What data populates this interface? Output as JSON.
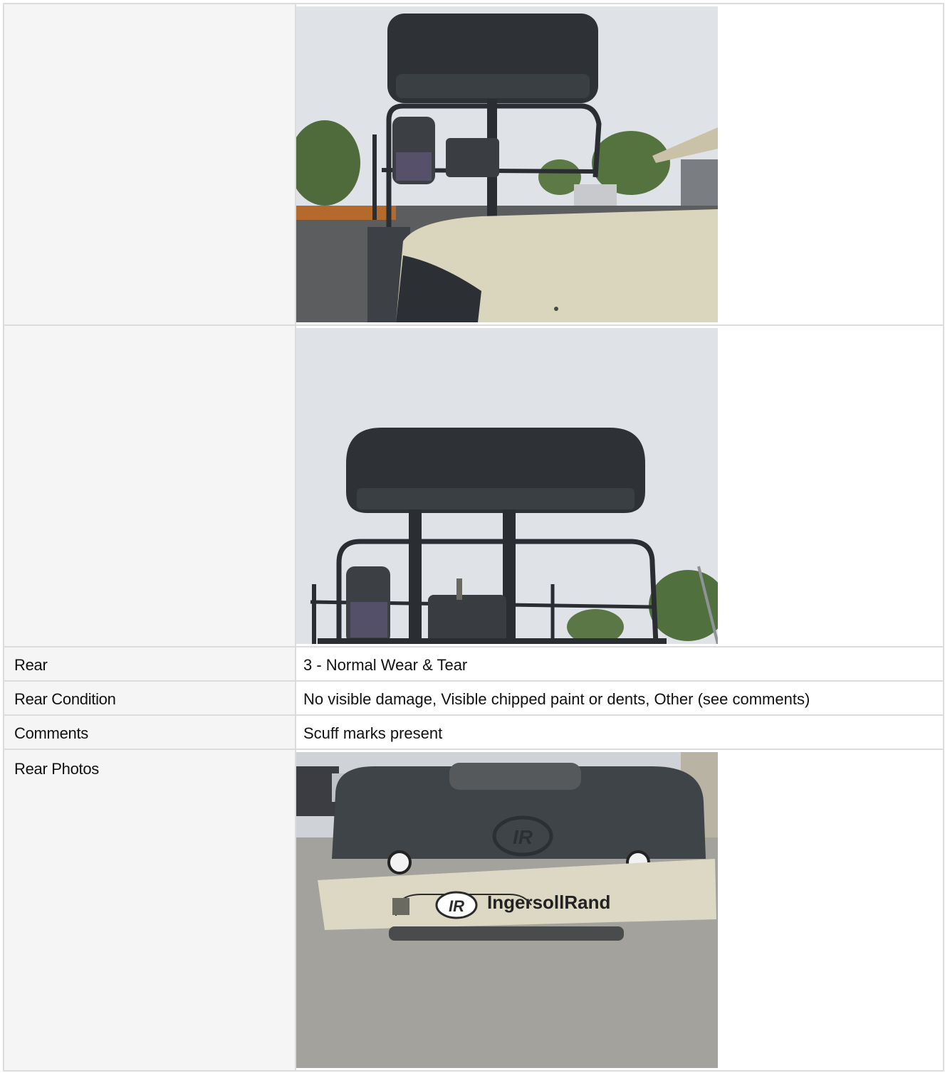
{
  "rows": [
    {
      "label": "",
      "type": "photo"
    },
    {
      "label": "",
      "type": "photo"
    },
    {
      "label": "Rear",
      "value": "3 - Normal Wear & Tear"
    },
    {
      "label": "Rear Condition",
      "value": "No visible damage, Visible chipped paint or dents, Other (see comments)"
    },
    {
      "label": "Comments",
      "value": "Scuff marks present"
    },
    {
      "label": "Rear Photos",
      "type": "photo"
    }
  ],
  "photos": {
    "photo1": {
      "icon": "roller-canopy-side-photo"
    },
    "photo2": {
      "icon": "roller-canopy-rear-photo"
    },
    "photo3": {
      "icon": "roller-rear-bumper-photo",
      "brand_text": "IngersollRand",
      "logo_text": "IR"
    }
  },
  "colors": {
    "sky": "#dfe3e8",
    "canopy": "#2e3236",
    "body_cream": "#d9d6bd",
    "border": "#dcdcdc",
    "label_bg": "#f5f5f5"
  }
}
